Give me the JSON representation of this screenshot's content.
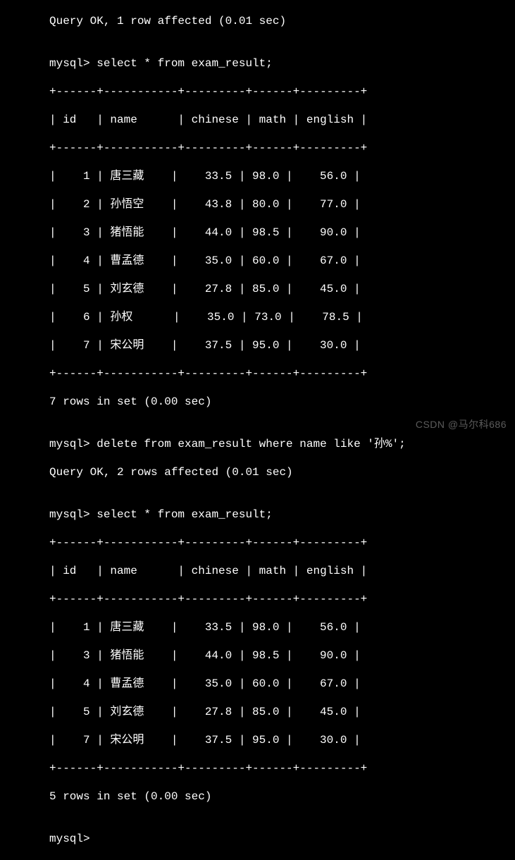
{
  "lines": {
    "partial_top": "Query OK, 1 row affected (0.01 sec)",
    "blank": "",
    "prompt1": "mysql> select * from exam_result;",
    "border1": "+------+-----------+---------+------+---------+",
    "header1": "| id   | name      | chinese | math | english |",
    "border2": "+------+-----------+---------+------+---------+",
    "r1": "|    1 | 唐三藏    |    33.5 | 98.0 |    56.0 |",
    "r2": "|    2 | 孙悟空    |    43.8 | 80.0 |    77.0 |",
    "r3": "|    3 | 猪悟能    |    44.0 | 98.5 |    90.0 |",
    "r4": "|    4 | 曹孟德    |    35.0 | 60.0 |    67.0 |",
    "r5": "|    5 | 刘玄德    |    27.8 | 85.0 |    45.0 |",
    "r6": "|    6 | 孙权      |    35.0 | 73.0 |    78.5 |",
    "r7": "|    7 | 宋公明    |    37.5 | 95.0 |    30.0 |",
    "border3": "+------+-----------+---------+------+---------+",
    "result1": "7 rows in set (0.00 sec)",
    "prompt2": "mysql> delete from exam_result where name like '孙%';",
    "result2": "Query OK, 2 rows affected (0.01 sec)",
    "prompt3": "mysql> select * from exam_result;",
    "border4": "+------+-----------+---------+------+---------+",
    "header2": "| id   | name      | chinese | math | english |",
    "border5": "+------+-----------+---------+------+---------+",
    "s1": "|    1 | 唐三藏    |    33.5 | 98.0 |    56.0 |",
    "s3": "|    3 | 猪悟能    |    44.0 | 98.5 |    90.0 |",
    "s4": "|    4 | 曹孟德    |    35.0 | 60.0 |    67.0 |",
    "s5": "|    5 | 刘玄德    |    27.8 | 85.0 |    45.0 |",
    "s7": "|    7 | 宋公明    |    37.5 | 95.0 |    30.0 |",
    "border6": "+------+-----------+---------+------+---------+",
    "result3": "5 rows in set (0.00 sec)",
    "prompt4": "mysql> "
  },
  "watermark": "CSDN @马尔科686"
}
